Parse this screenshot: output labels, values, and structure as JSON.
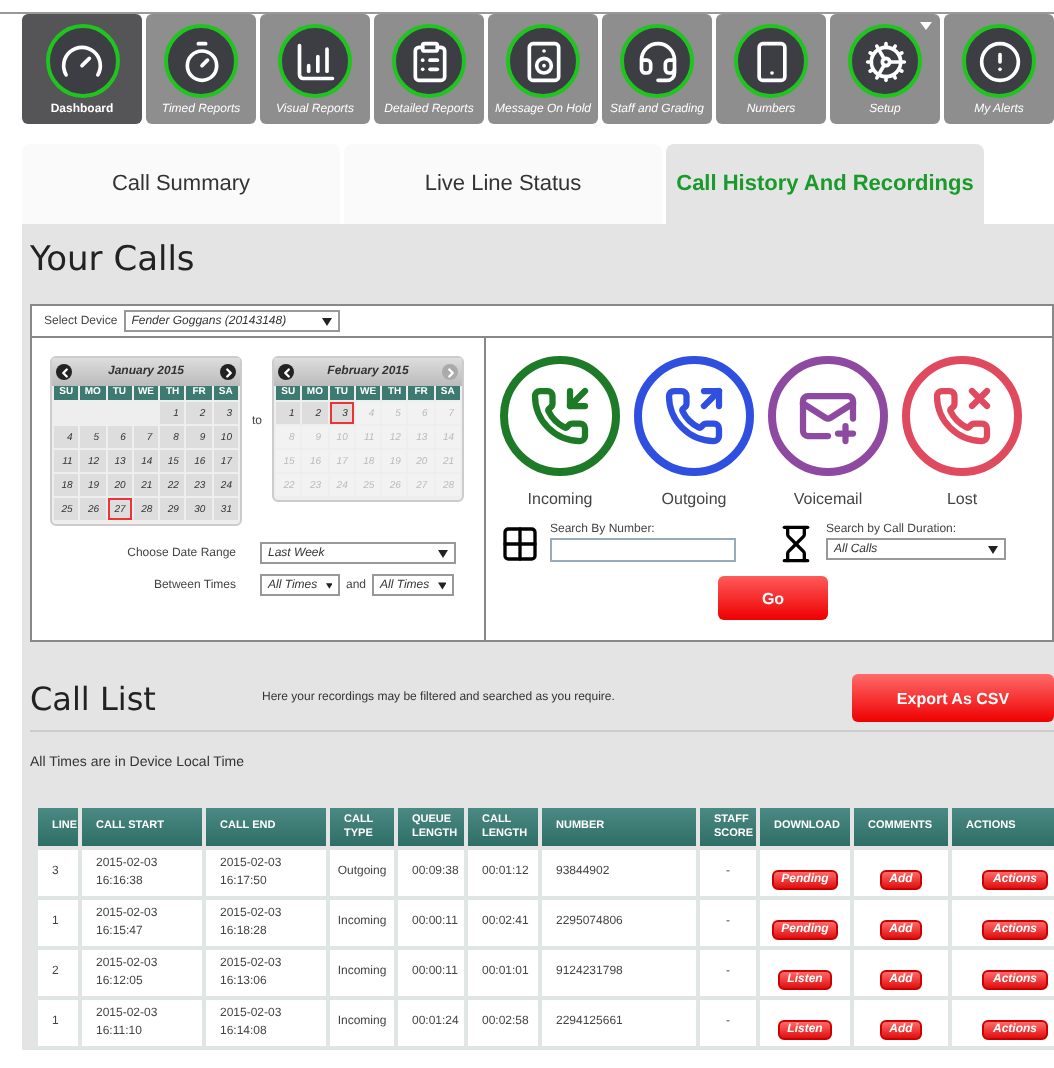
{
  "nav": [
    {
      "label": "Dashboard",
      "selected": true,
      "menu": false
    },
    {
      "label": "Timed Reports",
      "selected": false,
      "menu": false
    },
    {
      "label": "Visual Reports",
      "selected": false,
      "menu": false
    },
    {
      "label": "Detailed Reports",
      "selected": false,
      "menu": false
    },
    {
      "label": "Message On Hold",
      "selected": false,
      "menu": false
    },
    {
      "label": "Staff and Grading",
      "selected": false,
      "menu": false
    },
    {
      "label": "Numbers",
      "selected": false,
      "menu": false
    },
    {
      "label": "Setup",
      "selected": false,
      "menu": true
    },
    {
      "label": "My Alerts",
      "selected": false,
      "menu": false
    }
  ],
  "tabs": [
    {
      "label": "Call Summary",
      "selected": false
    },
    {
      "label": "Live Line Status",
      "selected": false
    },
    {
      "label": "Call History And Recordings",
      "selected": true
    }
  ],
  "page_title": "Your Calls",
  "device": {
    "label": "Select Device",
    "value": "Fender Goggans (20143148)"
  },
  "calendars": [
    {
      "title": "January 2015",
      "next_disabled": false,
      "weekdays": [
        "SU",
        "MO",
        "TU",
        "WE",
        "TH",
        "FR",
        "SA"
      ],
      "days": [
        {
          "kind": "blank"
        },
        {
          "kind": "blank"
        },
        {
          "kind": "blank"
        },
        {
          "kind": "blank"
        },
        {
          "kind": "day",
          "label": "1",
          "selected": false,
          "disabled": false
        },
        {
          "kind": "day",
          "label": "2",
          "selected": false,
          "disabled": false
        },
        {
          "kind": "day",
          "label": "3",
          "selected": false,
          "disabled": false
        },
        {
          "kind": "day",
          "label": "4",
          "selected": false,
          "disabled": false
        },
        {
          "kind": "day",
          "label": "5",
          "selected": false,
          "disabled": false
        },
        {
          "kind": "day",
          "label": "6",
          "selected": false,
          "disabled": false
        },
        {
          "kind": "day",
          "label": "7",
          "selected": false,
          "disabled": false
        },
        {
          "kind": "day",
          "label": "8",
          "selected": false,
          "disabled": false
        },
        {
          "kind": "day",
          "label": "9",
          "selected": false,
          "disabled": false
        },
        {
          "kind": "day",
          "label": "10",
          "selected": false,
          "disabled": false
        },
        {
          "kind": "day",
          "label": "11",
          "selected": false,
          "disabled": false
        },
        {
          "kind": "day",
          "label": "12",
          "selected": false,
          "disabled": false
        },
        {
          "kind": "day",
          "label": "13",
          "selected": false,
          "disabled": false
        },
        {
          "kind": "day",
          "label": "14",
          "selected": false,
          "disabled": false
        },
        {
          "kind": "day",
          "label": "15",
          "selected": false,
          "disabled": false
        },
        {
          "kind": "day",
          "label": "16",
          "selected": false,
          "disabled": false
        },
        {
          "kind": "day",
          "label": "17",
          "selected": false,
          "disabled": false
        },
        {
          "kind": "day",
          "label": "18",
          "selected": false,
          "disabled": false
        },
        {
          "kind": "day",
          "label": "19",
          "selected": false,
          "disabled": false
        },
        {
          "kind": "day",
          "label": "20",
          "selected": false,
          "disabled": false
        },
        {
          "kind": "day",
          "label": "21",
          "selected": false,
          "disabled": false
        },
        {
          "kind": "day",
          "label": "22",
          "selected": false,
          "disabled": false
        },
        {
          "kind": "day",
          "label": "23",
          "selected": false,
          "disabled": false
        },
        {
          "kind": "day",
          "label": "24",
          "selected": false,
          "disabled": false
        },
        {
          "kind": "day",
          "label": "25",
          "selected": false,
          "disabled": false
        },
        {
          "kind": "day",
          "label": "26",
          "selected": false,
          "disabled": false
        },
        {
          "kind": "day",
          "label": "27",
          "selected": true,
          "disabled": false
        },
        {
          "kind": "day",
          "label": "28",
          "selected": false,
          "disabled": false
        },
        {
          "kind": "day",
          "label": "29",
          "selected": false,
          "disabled": false
        },
        {
          "kind": "day",
          "label": "30",
          "selected": false,
          "disabled": false
        },
        {
          "kind": "day",
          "label": "31",
          "selected": false,
          "disabled": false
        }
      ]
    },
    {
      "title": "February 2015",
      "next_disabled": true,
      "weekdays": [
        "SU",
        "MO",
        "TU",
        "WE",
        "TH",
        "FR",
        "SA"
      ],
      "days": [
        {
          "kind": "day",
          "label": "1",
          "selected": false,
          "disabled": false
        },
        {
          "kind": "day",
          "label": "2",
          "selected": false,
          "disabled": false
        },
        {
          "kind": "day",
          "label": "3",
          "selected": true,
          "disabled": false
        },
        {
          "kind": "day",
          "label": "4",
          "selected": false,
          "disabled": true
        },
        {
          "kind": "day",
          "label": "5",
          "selected": false,
          "disabled": true
        },
        {
          "kind": "day",
          "label": "6",
          "selected": false,
          "disabled": true
        },
        {
          "kind": "day",
          "label": "7",
          "selected": false,
          "disabled": true
        },
        {
          "kind": "day",
          "label": "8",
          "selected": false,
          "disabled": true
        },
        {
          "kind": "day",
          "label": "9",
          "selected": false,
          "disabled": true
        },
        {
          "kind": "day",
          "label": "10",
          "selected": false,
          "disabled": true
        },
        {
          "kind": "day",
          "label": "11",
          "selected": false,
          "disabled": true
        },
        {
          "kind": "day",
          "label": "12",
          "selected": false,
          "disabled": true
        },
        {
          "kind": "day",
          "label": "13",
          "selected": false,
          "disabled": true
        },
        {
          "kind": "day",
          "label": "14",
          "selected": false,
          "disabled": true
        },
        {
          "kind": "day",
          "label": "15",
          "selected": false,
          "disabled": true
        },
        {
          "kind": "day",
          "label": "16",
          "selected": false,
          "disabled": true
        },
        {
          "kind": "day",
          "label": "17",
          "selected": false,
          "disabled": true
        },
        {
          "kind": "day",
          "label": "18",
          "selected": false,
          "disabled": true
        },
        {
          "kind": "day",
          "label": "19",
          "selected": false,
          "disabled": true
        },
        {
          "kind": "day",
          "label": "20",
          "selected": false,
          "disabled": true
        },
        {
          "kind": "day",
          "label": "21",
          "selected": false,
          "disabled": true
        },
        {
          "kind": "day",
          "label": "22",
          "selected": false,
          "disabled": true
        },
        {
          "kind": "day",
          "label": "23",
          "selected": false,
          "disabled": true
        },
        {
          "kind": "day",
          "label": "24",
          "selected": false,
          "disabled": true
        },
        {
          "kind": "day",
          "label": "25",
          "selected": false,
          "disabled": true
        },
        {
          "kind": "day",
          "label": "26",
          "selected": false,
          "disabled": true
        },
        {
          "kind": "day",
          "label": "27",
          "selected": false,
          "disabled": true
        },
        {
          "kind": "day",
          "label": "28",
          "selected": false,
          "disabled": true
        }
      ]
    }
  ],
  "range_joiner": "to",
  "date_range": {
    "label": "Choose Date Range",
    "value": "Last Week"
  },
  "between": {
    "label": "Between Times",
    "from": "All Times",
    "joiner": "and",
    "to": "All Times"
  },
  "call_types": [
    {
      "label": "Incoming",
      "color": "#1d7a26"
    },
    {
      "label": "Outgoing",
      "color": "#2f4fe0"
    },
    {
      "label": "Voicemail",
      "color": "#8d4aa0"
    },
    {
      "label": "Lost",
      "color": "#e04a5e"
    }
  ],
  "search_number": {
    "label": "Search By Number:"
  },
  "search_duration": {
    "label": "Search by Call Duration:",
    "value": "All Calls"
  },
  "go_button": "Go",
  "call_list": {
    "title": "Call List",
    "description": "Here your recordings may be filtered and searched as you require.",
    "export_button": "Export As CSV",
    "timezone_note": "All Times are in Device Local Time"
  },
  "table": {
    "columns": [
      "LINE",
      "CALL START",
      "CALL END",
      "CALL TYPE",
      "QUEUE LENGTH",
      "CALL LENGTH",
      "NUMBER",
      "STAFF SCORE",
      "DOWNLOAD",
      "COMMENTS",
      "ACTIONS"
    ],
    "rows": [
      {
        "cells": [
          "3",
          "2015-02-03 16:16:38",
          "2015-02-03 16:17:50",
          "Outgoing",
          "00:09:38",
          "00:01:12",
          "93844902",
          "-"
        ],
        "download": "Pending",
        "comment": "Add",
        "action": "Actions"
      },
      {
        "cells": [
          "1",
          "2015-02-03 16:15:47",
          "2015-02-03 16:18:28",
          "Incoming",
          "00:00:11",
          "00:02:41",
          "2295074806",
          "-"
        ],
        "download": "Pending",
        "comment": "Add",
        "action": "Actions"
      },
      {
        "cells": [
          "2",
          "2015-02-03 16:12:05",
          "2015-02-03 16:13:06",
          "Incoming",
          "00:00:11",
          "00:01:01",
          "9124231798",
          "-"
        ],
        "download": "Listen",
        "comment": "Add",
        "action": "Actions"
      },
      {
        "cells": [
          "1",
          "2015-02-03 16:11:10",
          "2015-02-03 16:14:08",
          "Incoming",
          "00:01:24",
          "00:02:58",
          "2294125661",
          "-"
        ],
        "download": "Listen",
        "comment": "Add",
        "action": "Actions"
      }
    ]
  }
}
